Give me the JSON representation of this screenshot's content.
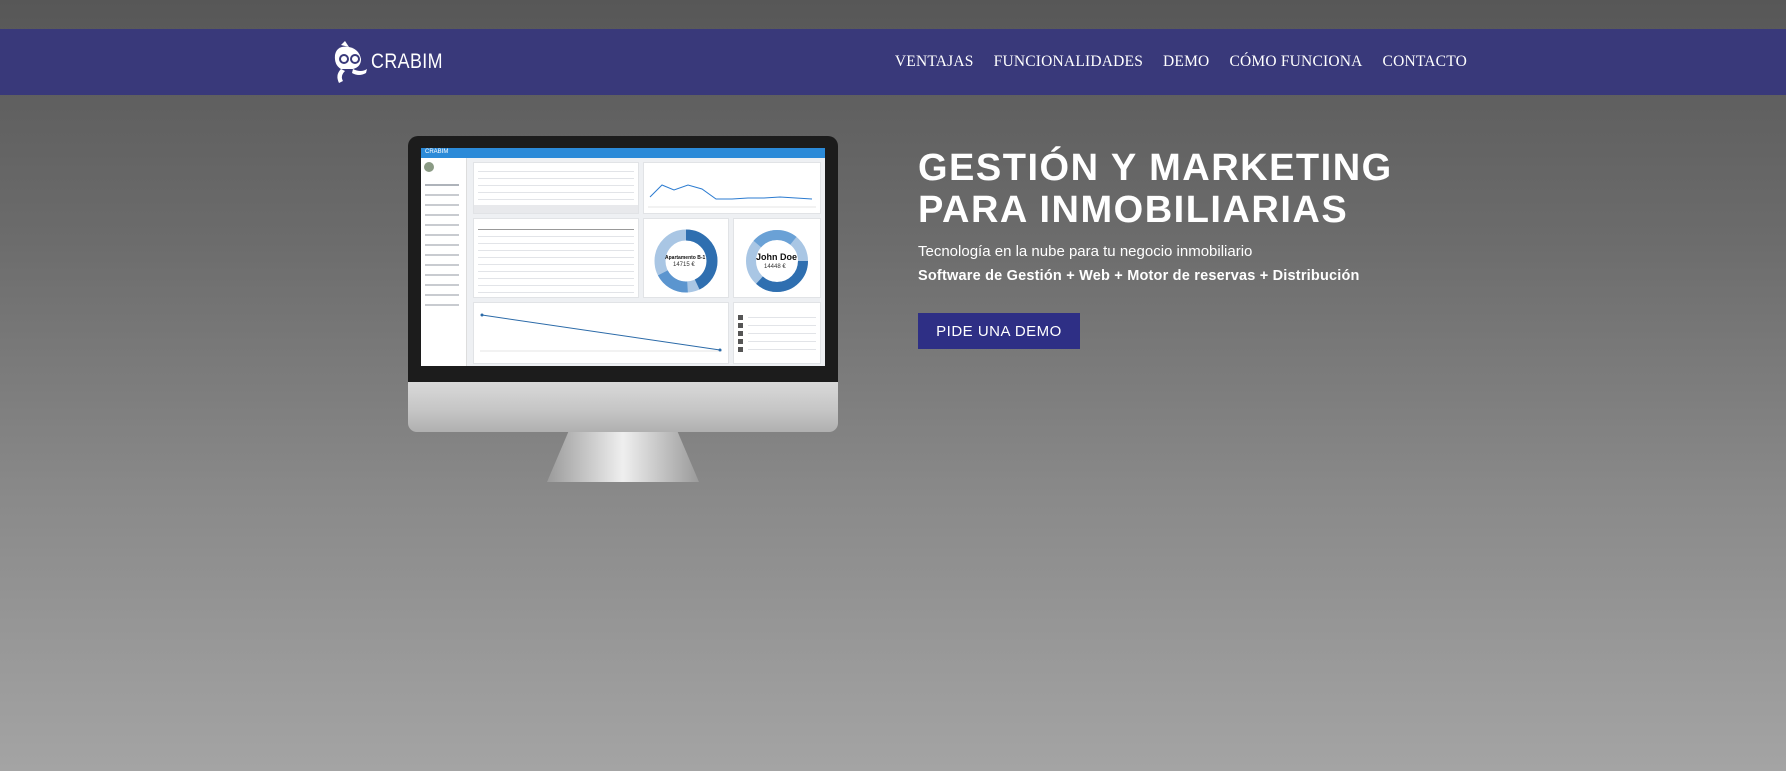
{
  "header": {
    "logo_text": "CRABIM",
    "nav": [
      "VENTAJAS",
      "FUNCIONALIDADES",
      "DEMO",
      "CÓMO FUNCIONA",
      "CONTACTO"
    ]
  },
  "hero": {
    "title_line1": "GESTIÓN Y MARKETING",
    "title_line2": "PARA INMOBILIARIAS",
    "subtitle": "Tecnología en la nube para tu negocio inmobiliario",
    "features": "Software de Gestión + Web + Motor de reservas + Distribución",
    "cta_label": "PIDE UNA DEMO"
  },
  "screen": {
    "app_name": "CRABIM",
    "donut1_label": "Apartamento B-1",
    "donut1_value": "14715 €",
    "donut2_label": "John Doe",
    "donut2_value": "14448 €"
  },
  "colors": {
    "header_bg": "#39397a",
    "cta_bg": "#2e2f85",
    "screen_accent": "#2b8ad8"
  }
}
